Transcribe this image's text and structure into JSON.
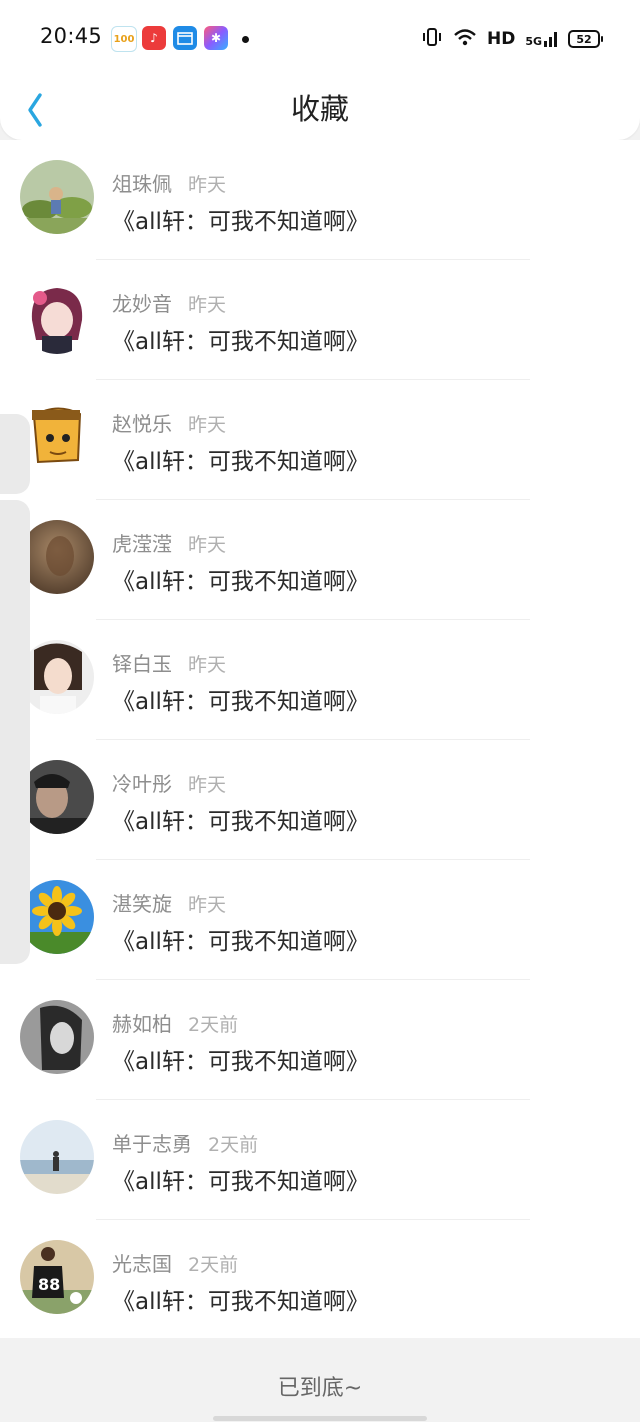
{
  "status_bar": {
    "time": "20:45",
    "hd": "HD",
    "network": "5G",
    "battery": "52"
  },
  "nav": {
    "title": "收藏",
    "back_icon": "chevron-left-icon"
  },
  "colors": {
    "accent": "#2aa6e0"
  },
  "items": [
    {
      "name": "俎珠佩",
      "time": "昨天",
      "content": "《all轩：可我不知道啊》"
    },
    {
      "name": "龙妙音",
      "time": "昨天",
      "content": "《all轩：可我不知道啊》"
    },
    {
      "name": "赵悦乐",
      "time": "昨天",
      "content": "《all轩：可我不知道啊》"
    },
    {
      "name": "虎滢滢",
      "time": "昨天",
      "content": "《all轩：可我不知道啊》"
    },
    {
      "name": "铎白玉",
      "time": "昨天",
      "content": "《all轩：可我不知道啊》"
    },
    {
      "name": "冷叶彤",
      "time": "昨天",
      "content": "《all轩：可我不知道啊》"
    },
    {
      "name": "湛笑旋",
      "time": "昨天",
      "content": "《all轩：可我不知道啊》"
    },
    {
      "name": "赫如柏",
      "time": "2天前",
      "content": "《all轩：可我不知道啊》"
    },
    {
      "name": "单于志勇",
      "time": "2天前",
      "content": "《all轩：可我不知道啊》"
    },
    {
      "name": "光志国",
      "time": "2天前",
      "content": "《all轩：可我不知道啊》"
    }
  ],
  "footer": {
    "end_text": "已到底~"
  }
}
